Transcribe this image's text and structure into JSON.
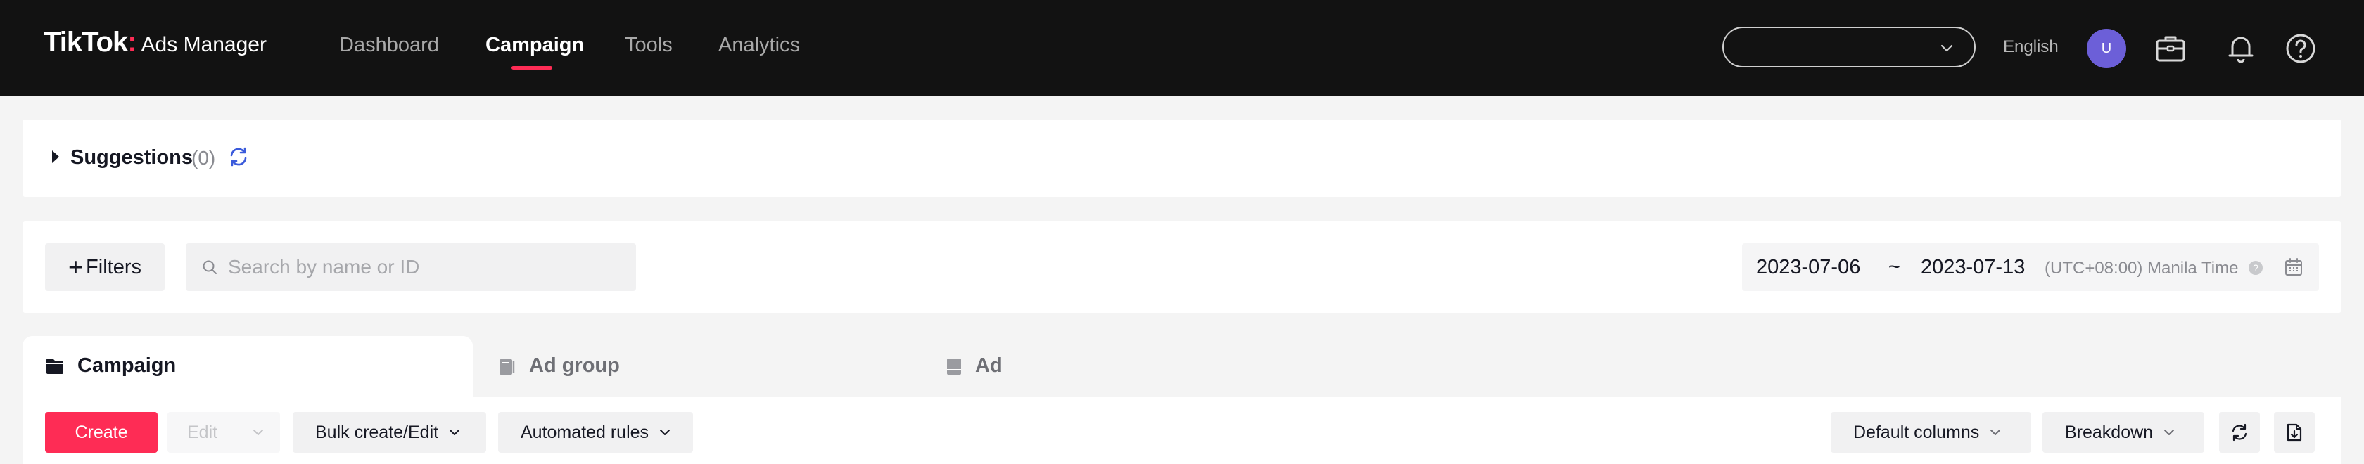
{
  "header": {
    "logo_main": "TikTok",
    "logo_dot": ":",
    "logo_sub": "Ads Manager",
    "nav": [
      {
        "label": "Dashboard",
        "active": false
      },
      {
        "label": "Campaign",
        "active": true
      },
      {
        "label": "Tools",
        "active": false
      },
      {
        "label": "Analytics",
        "active": false
      }
    ],
    "account_select_value": "",
    "language": "English",
    "avatar_initial": "U"
  },
  "suggestions": {
    "title": "Suggestions",
    "count": "(0)"
  },
  "filter_bar": {
    "filters_label": "Filters",
    "search_placeholder": "Search by name or ID",
    "date_start": "2023-07-06",
    "date_separator": "~",
    "date_end": "2023-07-13",
    "timezone": "(UTC+08:00) Manila Time"
  },
  "tabs": [
    {
      "label": "Campaign",
      "active": true,
      "icon": "folder-icon"
    },
    {
      "label": "Ad group",
      "active": false,
      "icon": "ad-group-icon"
    },
    {
      "label": "Ad",
      "active": false,
      "icon": "ad-icon"
    }
  ],
  "toolbar": {
    "create_label": "Create",
    "edit_label": "Edit",
    "bulk_label": "Bulk create/Edit",
    "rules_label": "Automated rules",
    "columns_label": "Default columns",
    "breakdown_label": "Breakdown"
  },
  "colors": {
    "brand": "#fe2c55",
    "topbar": "#121212",
    "avatar": "#6c5fd8",
    "refresh": "#3b5bdb"
  }
}
